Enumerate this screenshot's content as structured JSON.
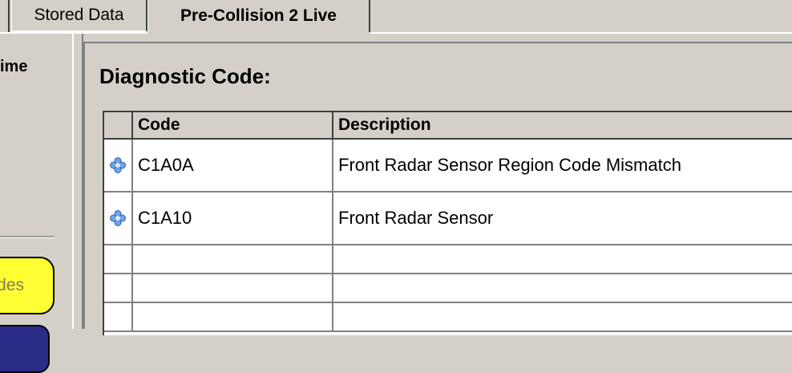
{
  "tabs": {
    "stored": "Stored Data",
    "live": "Pre-Collision 2 Live"
  },
  "left_panel": {
    "label_fragment": "ime",
    "button_fragment": "des"
  },
  "main": {
    "title": "Diagnostic Code:",
    "table": {
      "headers": {
        "code": "Code",
        "description": "Description"
      },
      "rows": [
        {
          "icon": "dtc-flower-icon",
          "code": "C1A0A",
          "description": "Front Radar Sensor Region Code Mismatch"
        },
        {
          "icon": "dtc-flower-icon",
          "code": "C1A10",
          "description": "Front Radar Sensor"
        },
        {
          "icon": "",
          "code": "",
          "description": ""
        },
        {
          "icon": "",
          "code": "",
          "description": ""
        },
        {
          "icon": "",
          "code": "",
          "description": ""
        }
      ]
    }
  },
  "colors": {
    "window_bg": "#d4d0c8",
    "codes_button": "#ffff33",
    "bottom_button": "#2b2b88",
    "icon_blue": "#5a8fe0"
  }
}
